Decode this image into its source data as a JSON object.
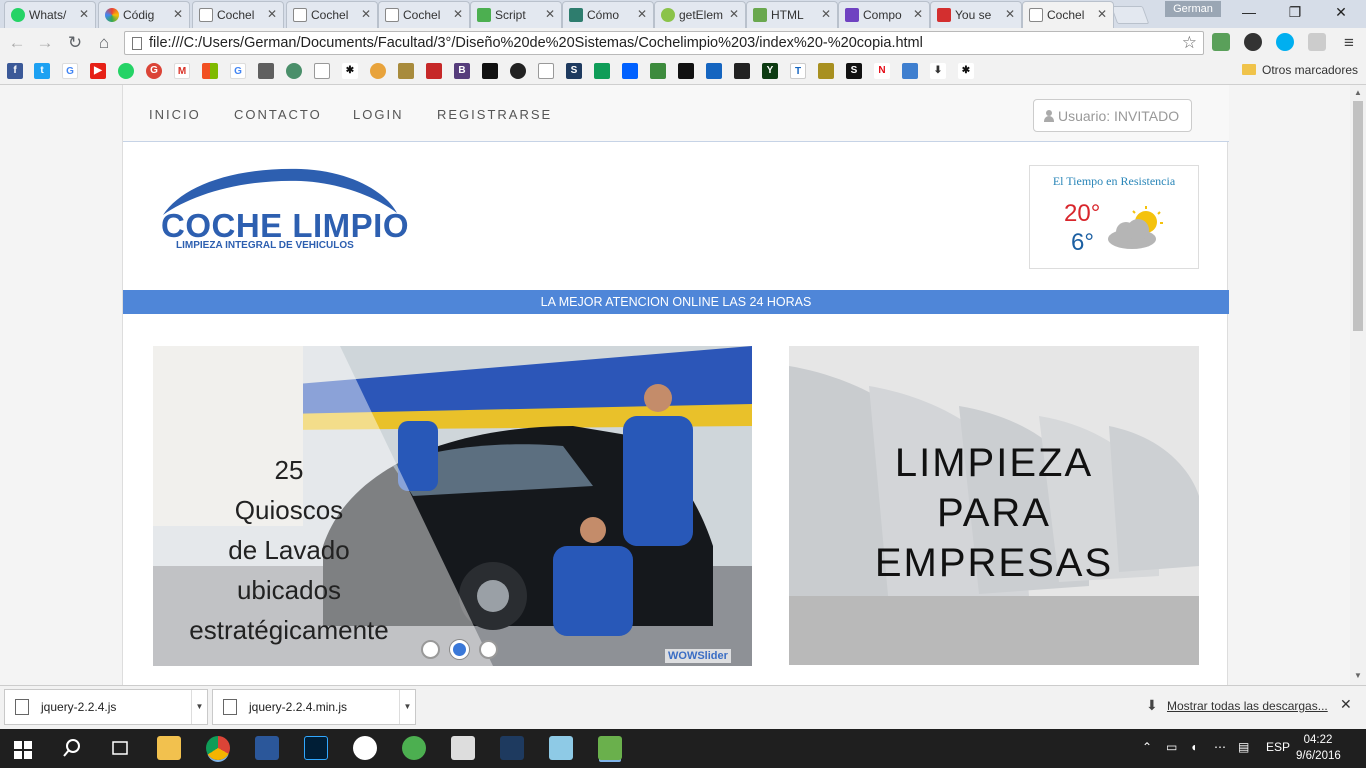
{
  "browser": {
    "tabs": [
      {
        "label": "Whats/",
        "color": "#25d366"
      },
      {
        "label": "Códig",
        "color": "#e94235"
      },
      {
        "label": "Cochel",
        "color": "#ffffff"
      },
      {
        "label": "Cochel",
        "color": "#ffffff"
      },
      {
        "label": "Cochel",
        "color": "#ffffff"
      },
      {
        "label": "Script",
        "color": "#4caf50"
      },
      {
        "label": "Cómo",
        "color": "#2e7d6e"
      },
      {
        "label": "getElem",
        "color": "#8bc34a"
      },
      {
        "label": "HTML",
        "color": "#6aa84f"
      },
      {
        "label": "Compo",
        "color": "#6f42c1"
      },
      {
        "label": "You se",
        "color": "#d32f2f"
      },
      {
        "label": "Cochel",
        "color": "#ffffff"
      }
    ],
    "profile": "German",
    "url": "file:///C:/Users/German/Documents/Facultad/3°/Diseño%20de%20Sistemas/Cochelimpio%203/index%20-%20copia.html",
    "other_bookmarks": "Otros marcadores"
  },
  "site": {
    "nav": [
      "INICIO",
      "CONTACTO",
      "LOGIN",
      "REGISTRARSE"
    ],
    "user_label": "Usuario: INVITADO",
    "logo_title": "COCHE LIMPIO",
    "logo_subtitle": "LIMPIEZA INTEGRAL DE VEHICULOS",
    "weather": {
      "title": "El Tiempo en Resistencia",
      "max": "20°",
      "min": "6°"
    },
    "banner": "LA MEJOR ATENCION ONLINE LAS 24 HORAS",
    "slider": {
      "caption_lines": [
        "25",
        "Quioscos",
        "de Lavado",
        "ubicados",
        "estratégicamente"
      ],
      "brand": "WOWSlider",
      "active_dot": 2
    },
    "empresas_lines": [
      "LIMPIEZA",
      "PARA",
      "EMPRESAS"
    ]
  },
  "downloads": {
    "items": [
      "jquery-2.2.4.js",
      "jquery-2.2.4.min.js"
    ],
    "show_all": "Mostrar todas las descargas..."
  },
  "taskbar": {
    "lang": "ESP",
    "time": "04:22",
    "date": "9/6/2016"
  }
}
